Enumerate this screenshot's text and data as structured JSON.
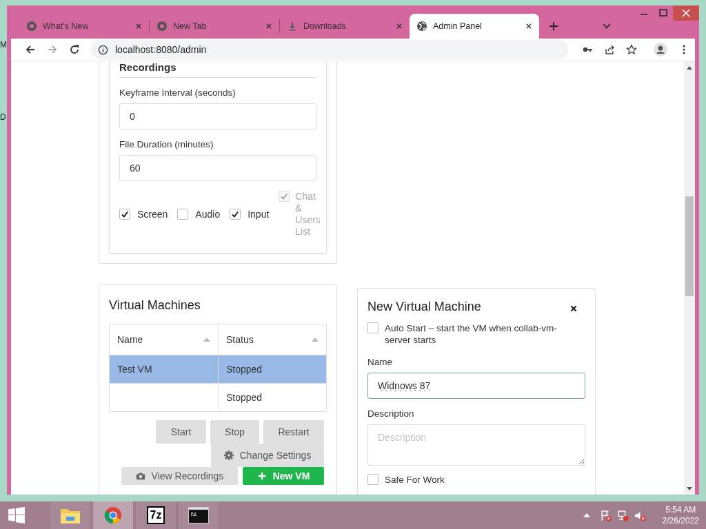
{
  "desktop": {
    "labels": [
      "M",
      "D"
    ]
  },
  "browser": {
    "tabs": [
      {
        "title": "What's New",
        "kind": "chrome",
        "selected": false
      },
      {
        "title": "New Tab",
        "kind": "chrome",
        "selected": false
      },
      {
        "title": "Downloads",
        "kind": "download",
        "selected": false
      },
      {
        "title": "Admin Panel",
        "kind": "globe",
        "selected": true
      }
    ],
    "address": "localhost:8080/admin"
  },
  "recordings": {
    "title": "Recordings",
    "fields": [
      {
        "label": "Keyframe Interval (seconds)",
        "value": "0"
      },
      {
        "label": "File Duration (minutes)",
        "value": "60"
      }
    ],
    "options": [
      {
        "label": "Screen",
        "checked": true,
        "disabled": false
      },
      {
        "label": "Audio",
        "checked": false,
        "disabled": false
      },
      {
        "label": "Input",
        "checked": true,
        "disabled": false
      },
      {
        "label": "Chat & Users List",
        "checked": true,
        "disabled": true
      }
    ]
  },
  "virtual_machines": {
    "title": "Virtual Machines",
    "columns": [
      {
        "label": "Name"
      },
      {
        "label": "Status"
      }
    ],
    "rows": [
      {
        "name": "Test VM",
        "status": "Stopped",
        "selected": true
      },
      {
        "status": "Stopped",
        "selected": false
      }
    ],
    "buttons": [
      {
        "label": "Start",
        "kind": "plain"
      },
      {
        "label": "Stop",
        "kind": "plain"
      },
      {
        "label": "Restart",
        "kind": "plain"
      },
      {
        "label": "Change Settings",
        "kind": "settings"
      },
      {
        "label": "View Recordings",
        "kind": "camera"
      },
      {
        "label": "New VM",
        "kind": "add"
      }
    ]
  },
  "new_vm": {
    "title": "New Virtual Machine",
    "auto_start": {
      "label": "Auto Start – start the VM when collab-vm-server starts",
      "checked": false
    },
    "name": {
      "label": "Name",
      "value": "Widnows 87"
    },
    "description": {
      "label": "Description",
      "placeholder": "Description"
    },
    "safe_for_work": {
      "label": "Safe For Work",
      "checked": false
    }
  },
  "taskbar": {
    "apps": [
      {
        "kind": "explorer",
        "selected": false
      },
      {
        "kind": "chrome",
        "selected": true
      },
      {
        "kind": "archiver",
        "label": "7z",
        "selected": false
      },
      {
        "kind": "terminal",
        "selected": false
      }
    ],
    "time": "5:54 AM",
    "date": "2/26/2022"
  }
}
